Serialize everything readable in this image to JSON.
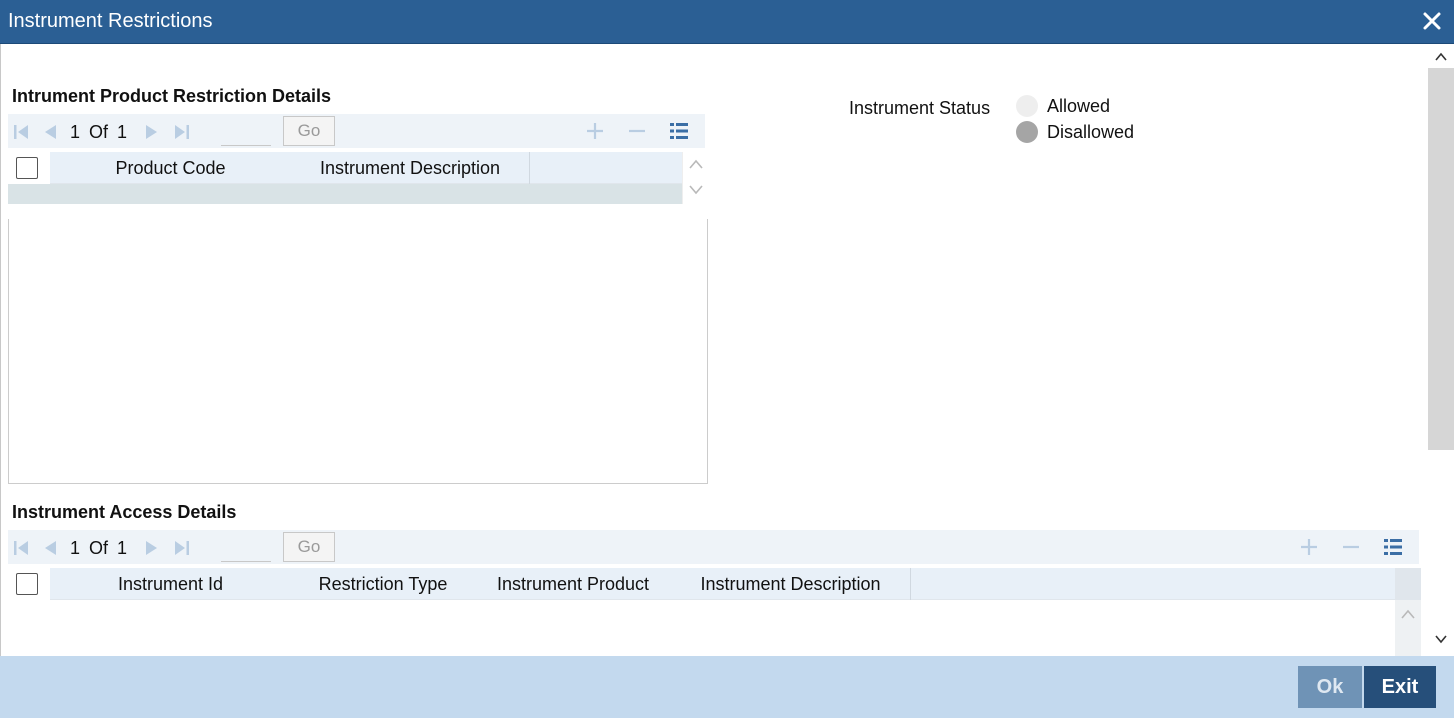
{
  "window": {
    "title": "Instrument Restrictions",
    "close_icon": "close-icon"
  },
  "section1": {
    "title": "Intrument Product Restriction Details",
    "pager": {
      "current": "1",
      "of_label": "Of",
      "total": "1",
      "go_label": "Go",
      "page_input": ""
    },
    "columns": [
      "Product Code",
      "Instrument Description"
    ]
  },
  "status": {
    "label": "Instrument Status",
    "options": [
      {
        "label": "Allowed",
        "selected": false
      },
      {
        "label": "Disallowed",
        "selected": true
      }
    ]
  },
  "section2": {
    "title": "Instrument Access Details",
    "pager": {
      "current": "1",
      "of_label": "Of",
      "total": "1",
      "go_label": "Go",
      "page_input": ""
    },
    "columns": [
      "Instrument Id",
      "Restriction Type",
      "Instrument Product",
      "Instrument Description"
    ]
  },
  "footer": {
    "ok_label": "Ok",
    "exit_label": "Exit"
  },
  "colors": {
    "titlebar": "#2b5f94",
    "footer": "#c3d9ee",
    "exit": "#264f7a",
    "ok": "#6f93b6"
  }
}
